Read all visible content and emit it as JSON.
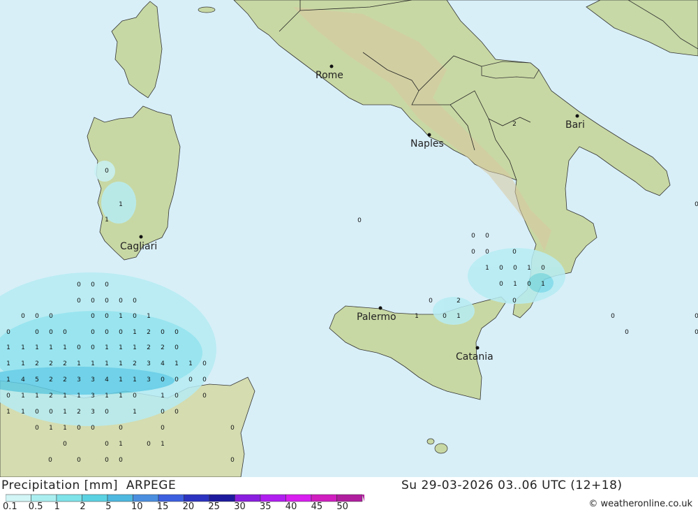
{
  "title": "Precipitation [mm]",
  "model": "ARPEGE",
  "valid_time": "Su 29-03-2026 03..06 UTC (12+18)",
  "credit": "© weatheronline.co.uk",
  "colors": {
    "sea": "#d8eff8",
    "land": "#c8d9a8",
    "precip_light": "#b7ecf3",
    "precip_mid": "#7ddbe9",
    "precip_heavy": "#4eb8e0"
  },
  "legend": {
    "labels": [
      "0.1",
      "0.5",
      "1",
      "2",
      "5",
      "10",
      "15",
      "20",
      "25",
      "30",
      "35",
      "40",
      "45",
      "50"
    ],
    "colors": [
      "#d2f5f6",
      "#aaeef0",
      "#7fe3ea",
      "#5bd2e2",
      "#4eb8e0",
      "#4b8ee0",
      "#3c5fe0",
      "#2c33c0",
      "#1e1a9e",
      "#8a1ee0",
      "#b01ef0",
      "#d81ef0",
      "#d01ec0",
      "#b01e9e"
    ]
  },
  "cities": [
    {
      "name": "Rome"
    },
    {
      "name": "Naples"
    },
    {
      "name": "Bari"
    },
    {
      "name": "Cagliari"
    },
    {
      "name": "Palermo"
    },
    {
      "name": "Catania"
    }
  ],
  "precip_values": [
    "0",
    "0",
    "0",
    "0",
    "0",
    "0",
    "0",
    "0",
    "0",
    "0",
    "0",
    "0",
    "0",
    "1",
    "0",
    "1",
    "0",
    "0",
    "0",
    "0",
    "0",
    "0",
    "0",
    "1",
    "2",
    "0",
    "0",
    "1",
    "1",
    "1",
    "1",
    "1",
    "0",
    "0",
    "1",
    "1",
    "1",
    "2",
    "2",
    "0",
    "1",
    "1",
    "2",
    "2",
    "2",
    "1",
    "1",
    "1",
    "1",
    "2",
    "3",
    "4",
    "1",
    "1",
    "0",
    "1",
    "4",
    "5",
    "2",
    "2",
    "3",
    "3",
    "4",
    "1",
    "1",
    "3",
    "0",
    "0",
    "0",
    "0",
    "0",
    "1",
    "1",
    "2",
    "1",
    "1",
    "3",
    "1",
    "1",
    "0",
    "1",
    "0",
    "0",
    "1",
    "1",
    "0",
    "0",
    "1",
    "2",
    "3",
    "0",
    "1",
    "0",
    "0",
    "0",
    "1",
    "1",
    "0",
    "0",
    "0",
    "0",
    "0",
    "0",
    "0",
    "1",
    "0",
    "1",
    "0",
    "0",
    "0",
    "0",
    "0",
    "1",
    "1",
    "0",
    "0",
    "0",
    "0",
    "0",
    "0",
    "0",
    "1",
    "0",
    "0",
    "1",
    "0",
    "0",
    "1",
    "0",
    "1",
    "0",
    "2",
    "0",
    "1",
    "0",
    "1",
    "2",
    "0",
    "0",
    "0",
    "0",
    "0",
    "0",
    "0"
  ]
}
